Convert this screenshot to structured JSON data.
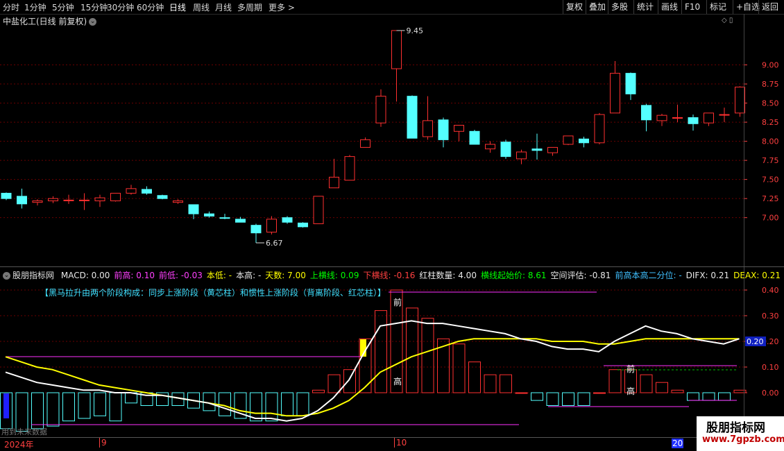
{
  "topbar": {
    "periods": [
      "分时",
      "1分钟",
      "5分钟",
      "15分钟",
      "30分钟",
      "60分钟",
      "日线",
      "周线",
      "月线",
      "多周期",
      "更多 >"
    ],
    "active_period": "日线",
    "right_buttons": [
      "复权",
      "叠加",
      "多股",
      "统计",
      "画线",
      "F10",
      "标记",
      "+自选",
      "返回"
    ]
  },
  "price_pane": {
    "title": "中盐化工(日线 前复权)",
    "y_ticks": [
      "9.00",
      "8.75",
      "8.50",
      "8.25",
      "8.00",
      "7.75",
      "7.50",
      "7.25",
      "7.00"
    ],
    "high_label": "9.45",
    "low_label": "6.67"
  },
  "indicator": {
    "name": "股朋指标网",
    "fields": [
      {
        "k": "MACD: ",
        "v": "0.00",
        "color": "#e8e8e8"
      },
      {
        "k": "前高: ",
        "v": "0.10",
        "color": "#ff40ff"
      },
      {
        "k": "前低: ",
        "v": "-0.03",
        "color": "#ff40ff"
      },
      {
        "k": "本低: ",
        "v": "-",
        "color": "#ffff00"
      },
      {
        "k": "本高: ",
        "v": "-",
        "color": "#e8e8e8"
      },
      {
        "k": "天数: ",
        "v": "7.00",
        "color": "#ffff00"
      },
      {
        "k": "上横线: ",
        "v": "0.09",
        "color": "#00ff00"
      },
      {
        "k": "下横线: ",
        "v": "-0.16",
        "color": "#ff4040"
      },
      {
        "k": "红柱数量: ",
        "v": "4.00",
        "color": "#e8e8e8"
      },
      {
        "k": "横线起始价: ",
        "v": "8.61",
        "color": "#00ff00"
      },
      {
        "k": "空间评估: ",
        "v": "-0.81",
        "color": "#e8e8e8"
      },
      {
        "k": "前高本高二分位: ",
        "v": "-",
        "color": "#40c0ff"
      },
      {
        "k": "DIFX: ",
        "v": "0.21",
        "color": "#e8e8e8"
      },
      {
        "k": "DEAX: ",
        "v": "0.21",
        "color": "#ffff00"
      }
    ],
    "note": "【黑马拉升由两个阶段构成：同步上涨阶段（黄芯柱）和惯性上涨阶段（背离阶段、红芯柱）】",
    "y_ticks": [
      "0.40",
      "0.30",
      "0.20",
      "0.10",
      "0.00"
    ],
    "current_value": "0.20",
    "labels": {
      "qian": "前",
      "gao": "高"
    }
  },
  "footer": {
    "note": "用到未来数据"
  },
  "dates": [
    "2024年",
    "9",
    "10",
    "20"
  ],
  "watermark": {
    "line1": "股朋指标网",
    "line2": "www.7gpzb.com"
  },
  "colors": {
    "up": "#ff3030",
    "down": "#54ffff",
    "dif": "#ffffff",
    "dea": "#ffff00",
    "magenta": "#ff30ff"
  },
  "candles": [
    {
      "o": 7.32,
      "h": 7.33,
      "l": 7.23,
      "c": 7.25
    },
    {
      "o": 7.28,
      "h": 7.38,
      "l": 7.12,
      "c": 7.18
    },
    {
      "o": 7.2,
      "h": 7.24,
      "l": 7.16,
      "c": 7.22
    },
    {
      "o": 7.22,
      "h": 7.28,
      "l": 7.19,
      "c": 7.25
    },
    {
      "o": 7.23,
      "h": 7.3,
      "l": 7.18,
      "c": 7.23
    },
    {
      "o": 7.23,
      "h": 7.32,
      "l": 7.1,
      "c": 7.23
    },
    {
      "o": 7.22,
      "h": 7.3,
      "l": 7.14,
      "c": 7.26
    },
    {
      "o": 7.22,
      "h": 7.32,
      "l": 7.21,
      "c": 7.32
    },
    {
      "o": 7.32,
      "h": 7.43,
      "l": 7.3,
      "c": 7.38
    },
    {
      "o": 7.37,
      "h": 7.41,
      "l": 7.3,
      "c": 7.32
    },
    {
      "o": 7.29,
      "h": 7.3,
      "l": 7.24,
      "c": 7.25
    },
    {
      "o": 7.2,
      "h": 7.24,
      "l": 7.18,
      "c": 7.22
    },
    {
      "o": 7.17,
      "h": 7.17,
      "l": 6.98,
      "c": 7.05
    },
    {
      "o": 7.05,
      "h": 7.08,
      "l": 7.0,
      "c": 7.02
    },
    {
      "o": 7.0,
      "h": 7.05,
      "l": 6.98,
      "c": 6.99
    },
    {
      "o": 6.98,
      "h": 7.01,
      "l": 6.94,
      "c": 6.94
    },
    {
      "o": 6.9,
      "h": 6.92,
      "l": 6.67,
      "c": 6.8
    },
    {
      "o": 6.81,
      "h": 7.02,
      "l": 6.78,
      "c": 6.98
    },
    {
      "o": 7.0,
      "h": 7.02,
      "l": 6.92,
      "c": 6.94
    },
    {
      "o": 6.93,
      "h": 6.94,
      "l": 6.87,
      "c": 6.88
    },
    {
      "o": 6.92,
      "h": 7.28,
      "l": 6.92,
      "c": 7.28
    },
    {
      "o": 7.39,
      "h": 7.77,
      "l": 7.39,
      "c": 7.53
    },
    {
      "o": 7.49,
      "h": 7.82,
      "l": 7.49,
      "c": 7.8
    },
    {
      "o": 7.92,
      "h": 8.05,
      "l": 7.92,
      "c": 8.02
    },
    {
      "o": 8.24,
      "h": 8.68,
      "l": 8.19,
      "c": 8.59
    },
    {
      "o": 8.95,
      "h": 9.45,
      "l": 8.52,
      "c": 9.45
    },
    {
      "o": 8.59,
      "h": 8.6,
      "l": 8.04,
      "c": 8.04
    },
    {
      "o": 8.06,
      "h": 8.59,
      "l": 8.02,
      "c": 8.27
    },
    {
      "o": 8.28,
      "h": 8.31,
      "l": 7.92,
      "c": 8.02
    },
    {
      "o": 8.13,
      "h": 8.18,
      "l": 8.0,
      "c": 8.21
    },
    {
      "o": 8.13,
      "h": 8.15,
      "l": 7.96,
      "c": 7.96
    },
    {
      "o": 7.9,
      "h": 8.0,
      "l": 7.85,
      "c": 7.96
    },
    {
      "o": 7.99,
      "h": 8.02,
      "l": 7.77,
      "c": 7.8
    },
    {
      "o": 7.77,
      "h": 7.89,
      "l": 7.7,
      "c": 7.86
    },
    {
      "o": 7.9,
      "h": 8.1,
      "l": 7.76,
      "c": 7.88
    },
    {
      "o": 7.85,
      "h": 7.92,
      "l": 7.81,
      "c": 7.92
    },
    {
      "o": 7.96,
      "h": 8.07,
      "l": 7.95,
      "c": 8.07
    },
    {
      "o": 8.03,
      "h": 8.06,
      "l": 7.92,
      "c": 7.98
    },
    {
      "o": 7.98,
      "h": 8.37,
      "l": 7.96,
      "c": 8.35
    },
    {
      "o": 8.37,
      "h": 9.05,
      "l": 8.37,
      "c": 8.89
    },
    {
      "o": 8.89,
      "h": 8.9,
      "l": 8.54,
      "c": 8.62
    },
    {
      "o": 8.47,
      "h": 8.49,
      "l": 8.13,
      "c": 8.28
    },
    {
      "o": 8.27,
      "h": 8.36,
      "l": 8.2,
      "c": 8.34
    },
    {
      "o": 8.31,
      "h": 8.48,
      "l": 8.25,
      "c": 8.31
    },
    {
      "o": 8.31,
      "h": 8.35,
      "l": 8.14,
      "c": 8.23
    },
    {
      "o": 8.24,
      "h": 8.37,
      "l": 8.2,
      "c": 8.37
    },
    {
      "o": 8.35,
      "h": 8.44,
      "l": 8.25,
      "c": 8.35
    },
    {
      "o": 8.37,
      "h": 8.72,
      "l": 8.32,
      "c": 8.71
    }
  ],
  "macd": [
    -0.14,
    -0.15,
    -0.14,
    -0.13,
    -0.11,
    -0.1,
    -0.09,
    -0.11,
    -0.04,
    -0.05,
    -0.05,
    -0.05,
    -0.06,
    -0.07,
    -0.09,
    -0.1,
    -0.11,
    -0.11,
    -0.09,
    -0.09,
    0.01,
    0.07,
    0.09,
    0.21,
    0.32,
    0.4,
    0.33,
    0.29,
    0.21,
    0.19,
    0.12,
    0.07,
    0.07,
    0.0,
    -0.03,
    -0.05,
    -0.05,
    -0.05,
    0.0,
    0.09,
    0.09,
    0.07,
    0.04,
    0.01,
    -0.03,
    -0.03,
    -0.03,
    0.01
  ],
  "dif": [
    0.08,
    0.06,
    0.04,
    0.03,
    0.02,
    0.01,
    0.01,
    0.0,
    0.0,
    -0.01,
    -0.01,
    -0.02,
    -0.03,
    -0.04,
    -0.06,
    -0.08,
    -0.1,
    -0.1,
    -0.11,
    -0.1,
    -0.07,
    -0.02,
    0.05,
    0.16,
    0.26,
    0.27,
    0.28,
    0.27,
    0.27,
    0.26,
    0.25,
    0.24,
    0.23,
    0.21,
    0.2,
    0.18,
    0.17,
    0.17,
    0.16,
    0.2,
    0.23,
    0.26,
    0.24,
    0.23,
    0.21,
    0.2,
    0.19,
    0.21
  ],
  "dea": [
    0.14,
    0.12,
    0.1,
    0.09,
    0.07,
    0.05,
    0.03,
    0.02,
    0.01,
    0.0,
    -0.01,
    -0.02,
    -0.03,
    -0.04,
    -0.05,
    -0.07,
    -0.08,
    -0.08,
    -0.09,
    -0.09,
    -0.08,
    -0.06,
    -0.03,
    0.02,
    0.08,
    0.11,
    0.14,
    0.16,
    0.18,
    0.2,
    0.21,
    0.21,
    0.21,
    0.21,
    0.21,
    0.2,
    0.2,
    0.2,
    0.19,
    0.19,
    0.2,
    0.21,
    0.21,
    0.21,
    0.21,
    0.21,
    0.21,
    0.21
  ]
}
